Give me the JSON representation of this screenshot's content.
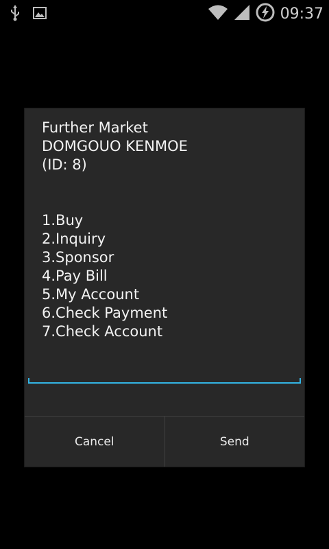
{
  "status_bar": {
    "time": "09:37",
    "icons": [
      "usb-icon",
      "image-icon",
      "wifi-icon",
      "signal-icon",
      "battery-charging-icon"
    ]
  },
  "dialog": {
    "header_lines": [
      "Further Market",
      "DOMGOUO KENMOE",
      "(ID: 8)"
    ],
    "menu_items": [
      "1.Buy",
      "2.Inquiry",
      "3.Sponsor",
      "4.Pay Bill",
      "5.My Account",
      "6.Check Payment",
      "7.Check Account"
    ],
    "input_value": "",
    "cancel_label": "Cancel",
    "send_label": "Send",
    "accent_color": "#33b5e5"
  }
}
